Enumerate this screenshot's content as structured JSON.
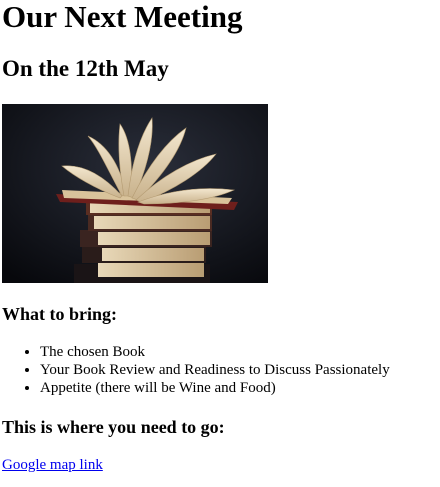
{
  "page": {
    "title": "Our Next Meeting",
    "subtitle": "On the 12th May"
  },
  "image": {
    "subject": "stack-of-books-icon"
  },
  "bring": {
    "heading": "What to bring:",
    "items": [
      "The chosen Book",
      "Your Book Review and Readiness to Discuss Passionately",
      "Appetite (there will be Wine and Food)"
    ]
  },
  "location": {
    "heading": "This is where you need to go:",
    "link_text": "Google map link"
  },
  "colors": {
    "link": "#0000ee",
    "text": "#000000",
    "image_background": "#0d0f16"
  }
}
